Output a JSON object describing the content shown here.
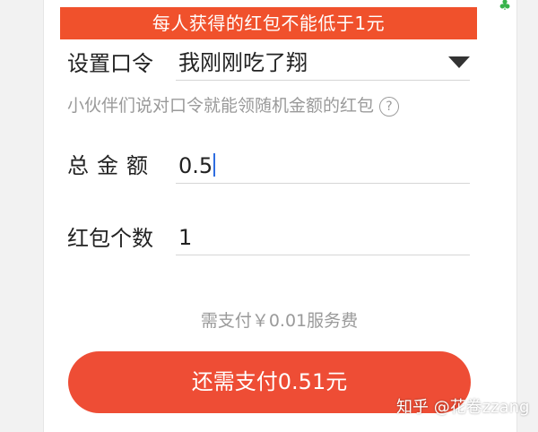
{
  "banner": {
    "error_text": "每人获得的红包不能低于1元"
  },
  "password": {
    "label": "设置口令",
    "value": "我刚刚吃了翔",
    "hint": "小伙伴们说对口令就能领随机金额的红包",
    "help_glyph": "?"
  },
  "amount": {
    "label": "总金额",
    "value": "0.5"
  },
  "count": {
    "label": "红包个数",
    "value": "1"
  },
  "fee": {
    "text": "需支付￥0.01服务费"
  },
  "pay_button": {
    "label": "还需支付0.51元"
  },
  "watermark": {
    "text": "知乎 @花卷zzang"
  },
  "colors": {
    "banner_bg": "#f0512c",
    "button_bg": "#ee4d35",
    "caret": "#2f6de0",
    "top_icon": "#37b34a"
  },
  "icons": {
    "top_right": "tree-icon",
    "dropdown": "triangle-down-icon",
    "help": "question-circle-icon"
  }
}
